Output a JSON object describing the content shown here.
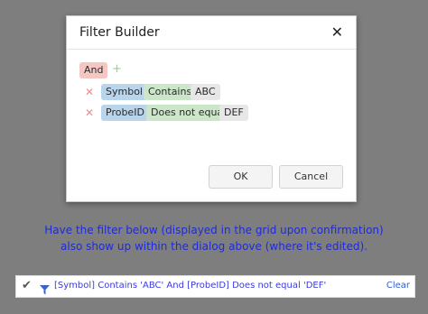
{
  "dialog": {
    "title": "Filter Builder",
    "close_icon": "✕",
    "group_operator": "And",
    "add_icon": "+",
    "remove_icon": "✕",
    "conditions": [
      {
        "field": "Symbol",
        "operator": "Contains",
        "value": "ABC"
      },
      {
        "field": "ProbeID",
        "operator": "Does not equal",
        "value": "DEF"
      }
    ],
    "ok_label": "OK",
    "cancel_label": "Cancel"
  },
  "note": {
    "line1": "Have the filter below (displayed in the grid upon confirmation)",
    "line2": "also show up within the dialog above (where it's edited)."
  },
  "filter_bar": {
    "check_icon": "✔",
    "expression": "[Symbol] Contains 'ABC' And [ProbeID] Does not equal 'DEF'",
    "clear_label": "Clear",
    "expression_color": "#3a3ae0"
  },
  "colors": {
    "group_tag": "#f4c7c3",
    "field_tag": "#b9d5ec",
    "operator_tag": "#cbe6c8",
    "value_tag": "#e7e7e7",
    "note_text": "#1f2bd6"
  }
}
